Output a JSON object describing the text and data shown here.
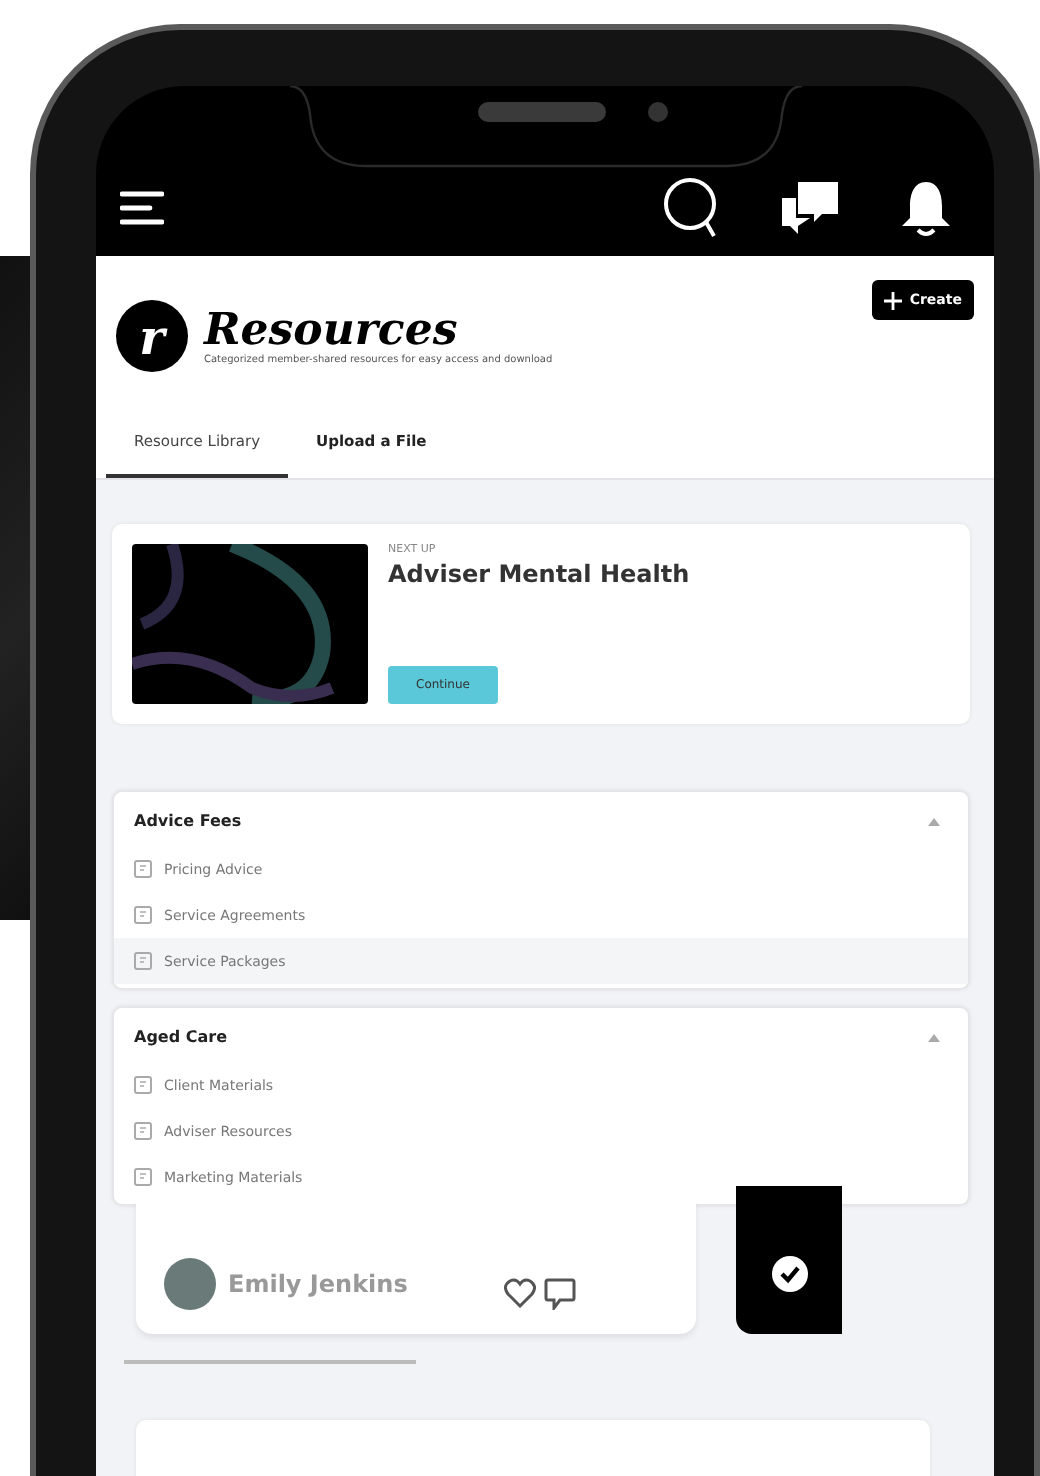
{
  "header": {
    "logo": "r",
    "title": "Resources",
    "subtitle": "Categorized member-shared resources for easy access and download",
    "create_button": "Create"
  },
  "tabs": [
    {
      "label": "Resource Library",
      "selected": true
    },
    {
      "label": "Upload a File",
      "selected": false
    }
  ],
  "next_up": {
    "eyebrow": "NEXT UP",
    "title": "Adviser Mental Health",
    "button": "Continue"
  },
  "categories": [
    {
      "title": "Advice Fees",
      "expanded": true,
      "items": [
        {
          "label": "Pricing Advice",
          "selected": false
        },
        {
          "label": "Service Agreements",
          "selected": false
        },
        {
          "label": "Service Packages",
          "selected": true
        }
      ]
    },
    {
      "title": "Aged Care",
      "expanded": true,
      "items": [
        {
          "label": "Client Materials",
          "selected": false
        },
        {
          "label": "Adviser Resources",
          "selected": false
        },
        {
          "label": "Marketing Materials",
          "selected": false
        }
      ]
    }
  ],
  "post": {
    "author": "Emily Jenkins"
  }
}
